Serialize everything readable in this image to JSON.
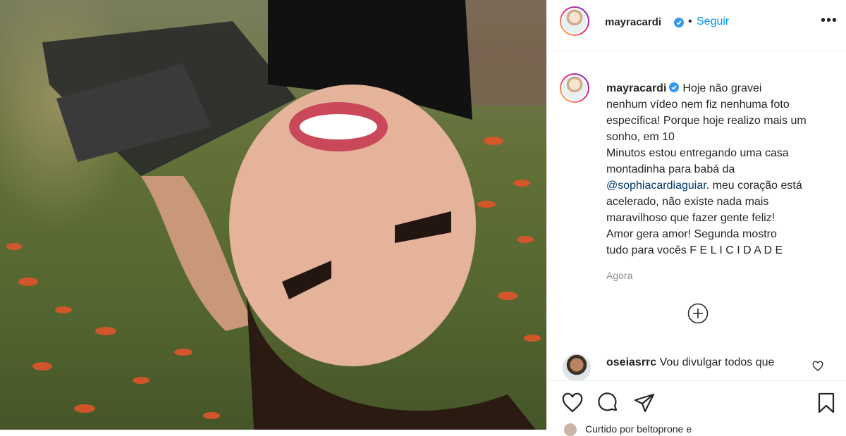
{
  "post": {
    "author": "mayracardi",
    "follow_separator": "•",
    "follow_label": "Seguir",
    "more_label": "•••"
  },
  "caption": {
    "author": "mayracardi",
    "text_part1": "Hoje não gravei\nnenhum vídeo nem fiz nenhuma foto\nespecífica! Porque hoje realizo mais um\nsonho, em 10\nMinutos estou entregando uma casa\nmontadinha para babá da\n",
    "mention": "@sophiacardiaguiar",
    "text_part2": ". meu coração está\nacelerado, não existe nada mais\nmaravilhoso que fazer gente feliz!\nAmor gera amor! Segunda mostro\ntudo para vocês F E L I C I D A D E"
  },
  "time": "Agora",
  "comment": {
    "author": "oseiasrrc",
    "text": "Vou divulgar todos que"
  },
  "liked_by": "Curtido por beltoprone e",
  "icons": {
    "verified": "verified-badge-icon",
    "more": "more-options-icon",
    "load_more": "add-circle-icon",
    "like": "heart-icon",
    "comment": "comment-icon",
    "share": "share-icon",
    "save": "bookmark-icon"
  },
  "colors": {
    "link": "#0095f6",
    "verified": "#3897f0",
    "text": "#262626",
    "muted": "#8e8e8e"
  }
}
